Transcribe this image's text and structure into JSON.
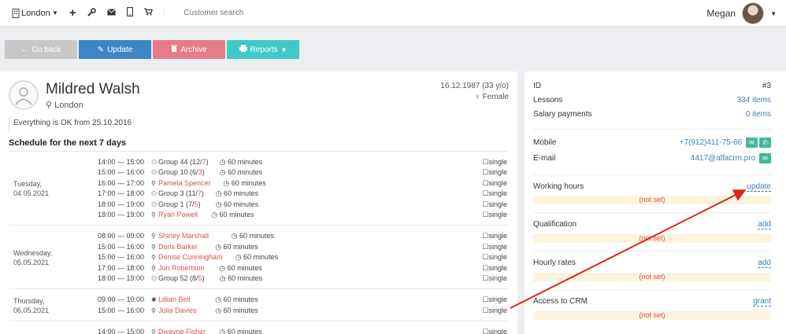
{
  "topbar": {
    "branch": "London",
    "search_placeholder": "Customer search",
    "user_name": "Megan"
  },
  "actions": {
    "back": "Go back",
    "update": "Update",
    "archive": "Archive",
    "reports": "Reports"
  },
  "customer": {
    "name": "Mildred Walsh",
    "city": "London",
    "dob": "16.12.1987 (33 y/o)",
    "gender": "Female",
    "note": "Everything is OK from 25.10.2016"
  },
  "schedule": {
    "title": "Schedule for the next 7 days",
    "days": [
      {
        "label1": "Tuesday,",
        "label2": "04.05.2021",
        "lessons": [
          {
            "time": "14:00 — 15:00",
            "type": "group",
            "name": "Group 44",
            "count_a": "12",
            "count_b": "7",
            "duration": "60 minutes",
            "kind": "single"
          },
          {
            "time": "15:00 — 16:00",
            "type": "group",
            "name": "Group 10",
            "count_a": "6",
            "count_b": "3",
            "duration": "60 minutes",
            "kind": "single"
          },
          {
            "time": "16:00 — 17:00",
            "type": "person",
            "name": "Pamela Spencer",
            "duration": "60 minutes",
            "kind": "single"
          },
          {
            "time": "17:00 — 18:00",
            "type": "group",
            "name": "Group 3",
            "count_a": "11",
            "count_b": "7",
            "duration": "60 minutes",
            "kind": "single"
          },
          {
            "time": "18:00 — 19:00",
            "type": "group",
            "name": "Group 1",
            "count_a": "7",
            "count_b": "5",
            "duration": "60 minutes",
            "kind": "single"
          },
          {
            "time": "18:00 — 19:00",
            "type": "person",
            "name": "Ryan Powell",
            "duration": "60 minutes",
            "kind": "single"
          }
        ]
      },
      {
        "label1": "Wednesday,",
        "label2": "05.05.2021",
        "lessons": [
          {
            "time": "08:00 — 09:00",
            "type": "person",
            "name": "Shirley Marshall",
            "duration": "60 minutes",
            "kind": "single"
          },
          {
            "time": "15:00 — 16:00",
            "type": "person",
            "name": "Doris Barker",
            "duration": "60 minutes",
            "kind": "single"
          },
          {
            "time": "15:00 — 16:00",
            "type": "person",
            "name": "Denise Cunningham",
            "duration": "60 minutes",
            "kind": "single"
          },
          {
            "time": "17:00 — 18:00",
            "type": "person",
            "name": "Jon Robertson",
            "duration": "60 minutes",
            "kind": "single"
          },
          {
            "time": "18:00 — 19:00",
            "type": "group",
            "name": "Group 52",
            "count_a": "8",
            "count_b": "5",
            "duration": "60 minutes",
            "kind": "single"
          }
        ]
      },
      {
        "label1": "Thursday,",
        "label2": "06.05.2021",
        "lessons": [
          {
            "time": "09:00 — 10:00",
            "type": "trial",
            "name": "Lillian Bell",
            "duration": "60 minutes",
            "kind": "single"
          },
          {
            "time": "15:00 — 16:00",
            "type": "person",
            "name": "Julia Davies",
            "duration": "60 minutes",
            "kind": "single"
          }
        ]
      },
      {
        "label1": "",
        "label2": "",
        "lessons": [
          {
            "time": "14:00 — 15:00",
            "type": "person",
            "name": "Dwayne Fisher",
            "duration": "60 minutes",
            "kind": "single"
          }
        ]
      }
    ]
  },
  "info": {
    "id_label": "ID",
    "id_value": "#3",
    "lessons_label": "Lessons",
    "lessons_value": "334 items",
    "salary_label": "Salary payments",
    "salary_value": "0 items",
    "mobile_label": "Mobile",
    "mobile_value": "+7(912)411-75-66",
    "email_label": "E-mail",
    "email_value": "4417@alfacrm.pro",
    "working_label": "Working hours",
    "working_link": "update",
    "working_value": "(not set)",
    "qual_label": "Qualification",
    "qual_link": "add",
    "qual_value": "(not set)",
    "rates_label": "Hourly rates",
    "rates_link": "add",
    "rates_value": "(not set)",
    "crm_label": "Access to CRM",
    "crm_link": "grant",
    "crm_value": "(not set)"
  }
}
